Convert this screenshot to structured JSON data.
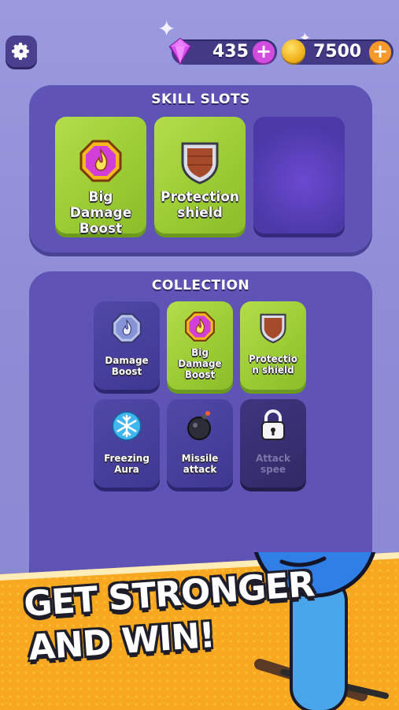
{
  "currency": {
    "gems": "435",
    "coins": "7500",
    "plus_gem": "+",
    "plus_coin": "+"
  },
  "skill_slots": {
    "title": "SKILL SLOTS",
    "slots": [
      {
        "label_line1": "Big Damage",
        "label_line2": "Boost",
        "icon": "flame-badge-icon"
      },
      {
        "label_line1": "Protection",
        "label_line2": "shield",
        "icon": "shield-icon"
      },
      {
        "label_line1": "",
        "label_line2": "",
        "icon": "empty-slot"
      }
    ]
  },
  "collection": {
    "title": "COLLECTION",
    "items": [
      {
        "lines": [
          "Damage",
          "Boost"
        ],
        "icon": "flame-badge-icon",
        "state": "locked-style"
      },
      {
        "lines": [
          "Big",
          "Damage",
          "Boost"
        ],
        "icon": "flame-badge-icon",
        "state": "equipped"
      },
      {
        "lines": [
          "Protectio",
          "n shield"
        ],
        "icon": "shield-icon",
        "state": "equipped"
      },
      {
        "lines": [
          "Freezing",
          "Aura"
        ],
        "icon": "snowflake-icon",
        "state": "owned"
      },
      {
        "lines": [
          "Missile",
          "attack"
        ],
        "icon": "bomb-icon",
        "state": "owned"
      },
      {
        "lines": [
          "Attack",
          "spee"
        ],
        "icon": "lock-icon",
        "state": "locked"
      }
    ]
  },
  "banner": {
    "line1": "GET STRONGER",
    "line2": "AND WIN!"
  },
  "colors": {
    "background": "#8f8fd6",
    "panel": "#5f54b5",
    "equipped_card": "#9ccc34",
    "banner": "#f7a820",
    "gem": "#c93ee0",
    "coin": "#f0b21c"
  }
}
